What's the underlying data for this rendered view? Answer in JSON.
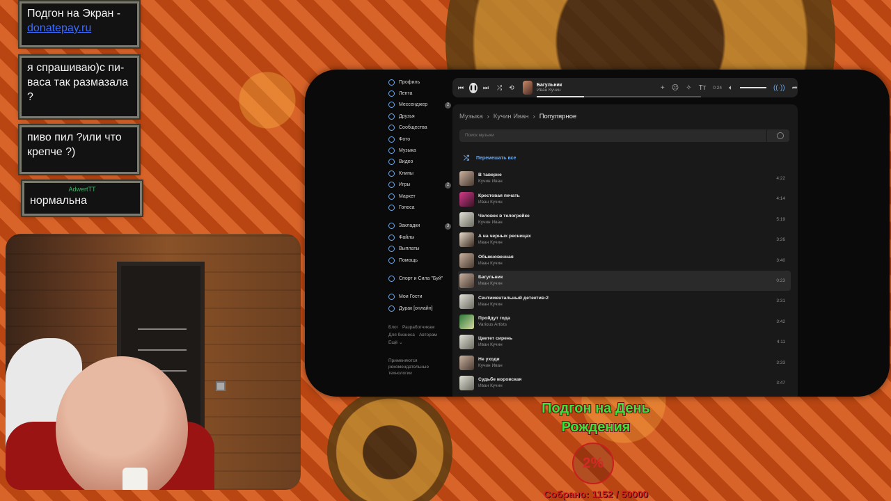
{
  "chat": {
    "messages": [
      {
        "author": "",
        "text": "Подгон на Экран - ",
        "link": "donatepay.ru"
      },
      {
        "author": "",
        "text": "я спрашиваю)с пи-васа так размазала ?"
      },
      {
        "author": "",
        "text": "пиво пил ?или что крепче ?)"
      },
      {
        "author": "AdwertTT",
        "text": "нормальна"
      }
    ]
  },
  "vk": {
    "sidebar": {
      "items": [
        {
          "label": "Профиль",
          "icon": "profile-icon",
          "count": ""
        },
        {
          "label": "Лента",
          "icon": "news-icon",
          "count": ""
        },
        {
          "label": "Мессенджер",
          "icon": "messenger-icon",
          "count": "2"
        },
        {
          "label": "Друзья",
          "icon": "friends-icon",
          "count": ""
        },
        {
          "label": "Сообщества",
          "icon": "communities-icon",
          "count": ""
        },
        {
          "label": "Фото",
          "icon": "photo-icon",
          "count": ""
        },
        {
          "label": "Музыка",
          "icon": "music-icon",
          "count": ""
        },
        {
          "label": "Видео",
          "icon": "video-icon",
          "count": ""
        },
        {
          "label": "Клипы",
          "icon": "clips-icon",
          "count": ""
        },
        {
          "label": "Игры",
          "icon": "games-icon",
          "count": "2"
        },
        {
          "label": "Маркет",
          "icon": "market-icon",
          "count": ""
        },
        {
          "label": "Голоса",
          "icon": "votes-icon",
          "count": ""
        }
      ],
      "items2": [
        {
          "label": "Закладки",
          "icon": "bookmarks-icon",
          "count": "3"
        },
        {
          "label": "Файлы",
          "icon": "files-icon",
          "count": ""
        },
        {
          "label": "Выплаты",
          "icon": "payments-icon",
          "count": ""
        },
        {
          "label": "Помощь",
          "icon": "help-icon",
          "count": ""
        }
      ],
      "groups": [
        {
          "label": "Спорт и Сила \"Буй\"",
          "icon": "group-icon"
        }
      ],
      "apps": [
        {
          "label": "Мои Гости",
          "icon": "guests-icon"
        },
        {
          "label": "Дурак [онлайн]",
          "icon": "cards-icon"
        }
      ],
      "footer": {
        "blog": "Блог",
        "devs": "Разработчикам",
        "business": "Для бизнеса",
        "authors": "Авторам",
        "more": "Ещё ⌄",
        "note": "Применяются рекомендательные технологии"
      }
    },
    "player": {
      "title": "Багульник",
      "artist": "Иван Кучин",
      "time": "0:24",
      "progress": 0.29,
      "volume": 1.0
    },
    "breadcrumb": [
      "Музыка",
      "Кучин Иван",
      "Популярное"
    ],
    "search_placeholder": "Поиск музыки",
    "shuffle_label": "Перемешать все",
    "tracks": [
      {
        "title": "В таверне",
        "artist": "Кучин Иван",
        "duration": "4:22"
      },
      {
        "title": "Крестовая печать",
        "artist": "Иван Кучин",
        "duration": "4:14"
      },
      {
        "title": "Человек в телогрейке",
        "artist": "Кучин Иван",
        "duration": "5:19"
      },
      {
        "title": "А на черных ресницах",
        "artist": "Иван Кучин",
        "duration": "3:26"
      },
      {
        "title": "Обыкновенная",
        "artist": "Иван Кучин",
        "duration": "3:40"
      },
      {
        "title": "Багульник",
        "artist": "Иван Кучин",
        "duration": "0:23"
      },
      {
        "title": "Сентиментальный детектив-2",
        "artist": "Иван Кучин",
        "duration": "3:31"
      },
      {
        "title": "Пройдут года",
        "artist": "Various Artists",
        "duration": "3:42"
      },
      {
        "title": "Цветет сирень",
        "artist": "Иван Кучин",
        "duration": "4:11"
      },
      {
        "title": "Не уходи",
        "artist": "Кучин Иван",
        "duration": "3:33"
      },
      {
        "title": "Судьбе воровская",
        "artist": "Иван Кучин",
        "duration": "3:47"
      }
    ],
    "active_track_index": 5,
    "accent_color": "#71aaeb"
  },
  "goal": {
    "title": "Подгон на День Рождения",
    "percent": "2%",
    "collected": "Собрано: 1152 / 50000"
  }
}
